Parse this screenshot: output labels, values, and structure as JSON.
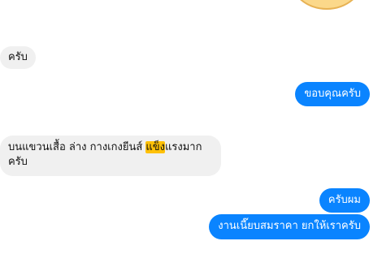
{
  "messages": [
    {
      "direction": "incoming",
      "text": "ครับ"
    },
    {
      "direction": "outgoing",
      "text": "ขอบคุณครับ"
    },
    {
      "direction": "incoming",
      "before": "บนแขวนเสื้อ ล่าง กางเกงยีนส์ ",
      "highlight": "แข็ง",
      "after": "แรงมาก ครับ"
    },
    {
      "direction": "outgoing",
      "text": "ครับผม"
    },
    {
      "direction": "outgoing",
      "text": "งานเนี๊ยบสมราคา ยกให้เราครับ"
    }
  ],
  "colors": {
    "outgoing_bubble": "#0a84ff",
    "incoming_bubble": "#f0f0f0",
    "highlight": "#ffc107"
  },
  "sticker": {
    "icon": "sticker-image"
  }
}
